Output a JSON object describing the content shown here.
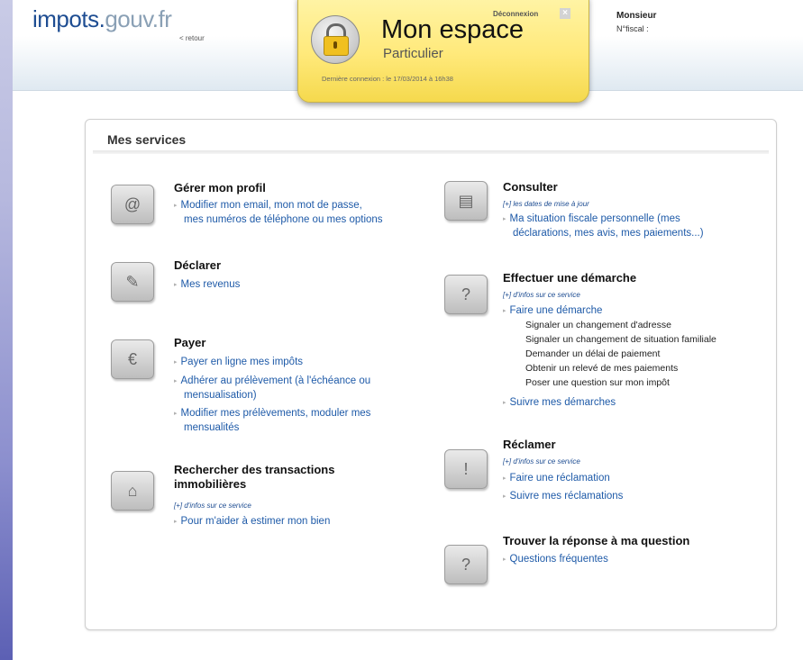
{
  "header": {
    "logo_part1": "impots.",
    "logo_part2": "gouv.fr",
    "retour": "< retour",
    "deconnexion": "Déconnexion",
    "close_symbol": "×",
    "title": "Mon espace",
    "subtitle": "Particulier",
    "derniere_connexion": "Dernière connexion : le 17/03/2014 à 16h38",
    "user_title": "Monsieur",
    "user_fiscal": "N°fiscal :"
  },
  "services": {
    "title": "Mes services",
    "gerer": {
      "title": "Gérer mon profil",
      "link1_line1": "Modifier mon email, mon mot de passe,",
      "link1_line2": "mes numéros de téléphone ou mes options"
    },
    "declarer": {
      "title": "Déclarer",
      "link1": "Mes revenus"
    },
    "payer": {
      "title": "Payer",
      "link1": "Payer en ligne mes impôts",
      "link2_line1": "Adhérer au prélèvement (à l'échéance ou",
      "link2_line2": "mensualisation)",
      "link3_line1": "Modifier mes prélèvements, moduler mes",
      "link3_line2": "mensualités"
    },
    "transactions": {
      "title_line1": "Rechercher des transactions",
      "title_line2": "immobilières",
      "info": "[+] d'infos sur ce service",
      "link1": "Pour m'aider à estimer mon bien"
    },
    "consulter": {
      "title": "Consulter",
      "info": "[+] les dates de mise à jour",
      "link1_line1": "Ma situation fiscale personnelle (mes",
      "link1_line2": "déclarations, mes avis, mes paiements...)"
    },
    "demarche": {
      "title": "Effectuer une démarche",
      "info": "[+] d'infos sur ce service",
      "link1": "Faire une démarche",
      "sub": [
        "Signaler un changement d'adresse",
        "Signaler un changement de situation familiale",
        "Demander un délai de paiement",
        "Obtenir un relevé de mes paiements",
        "Poser une question sur mon impôt"
      ],
      "link2": "Suivre mes démarches"
    },
    "reclamer": {
      "title": "Réclamer",
      "info": "[+] d'infos sur ce service",
      "link1": "Faire une réclamation",
      "link2": "Suivre mes réclamations"
    },
    "question": {
      "title": "Trouver la réponse à ma question",
      "link1": "Questions fréquentes"
    }
  },
  "icons": {
    "triangle": "▸",
    "profile": "@",
    "declare": "✎",
    "pay": "€",
    "house": "⌂",
    "consult": "▤",
    "demarche": "?",
    "reclamer": "!",
    "question": "?"
  }
}
